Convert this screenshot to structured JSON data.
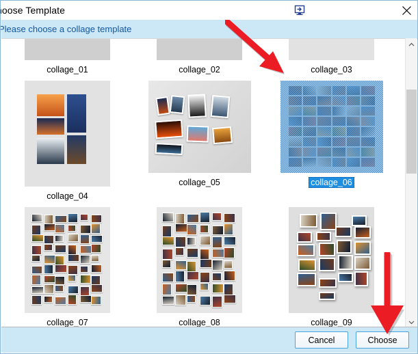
{
  "window": {
    "title": "hoose Template",
    "title_icon": "monitor-arrow-icon",
    "close_icon": "close-icon"
  },
  "banner": {
    "text": "Please choose a collage template",
    "background_color": "#cce8f7",
    "text_color": "#12569e"
  },
  "templates": {
    "rows": [
      [
        {
          "caption": "collage_01",
          "selected": false,
          "style": "cut-off"
        },
        {
          "caption": "collage_02",
          "selected": false,
          "style": "cut-off"
        },
        {
          "caption": "collage_03",
          "selected": false,
          "style": "cut-off"
        }
      ],
      [
        {
          "caption": "collage_04",
          "selected": false,
          "style": "five-photo-grid"
        },
        {
          "caption": "collage_05",
          "selected": false,
          "style": "scattered-polaroids"
        },
        {
          "caption": "collage_06",
          "selected": true,
          "style": "dense-blue-grid"
        }
      ],
      [
        {
          "caption": "collage_07",
          "selected": false,
          "style": "dense-white-border-grid"
        },
        {
          "caption": "collage_08",
          "selected": false,
          "style": "tight-mosaic"
        },
        {
          "caption": "collage_09",
          "selected": false,
          "style": "loose-scatter"
        }
      ]
    ],
    "selected_caption": "collage_06",
    "selection_color": "#1e8fe0"
  },
  "scrollbar": {
    "up_arrow": "chevron-up-icon",
    "down_arrow": "chevron-down-icon",
    "thumb_color": "#cdcdcd"
  },
  "footer": {
    "cancel_label": "Cancel",
    "choose_label": "Choose",
    "button_border_color": "#4aa3df"
  },
  "annotations": {
    "arrow_to_template": "red-diagonal-arrow",
    "arrow_to_choose": "red-down-arrow",
    "arrow_color": "#ec1c24"
  }
}
